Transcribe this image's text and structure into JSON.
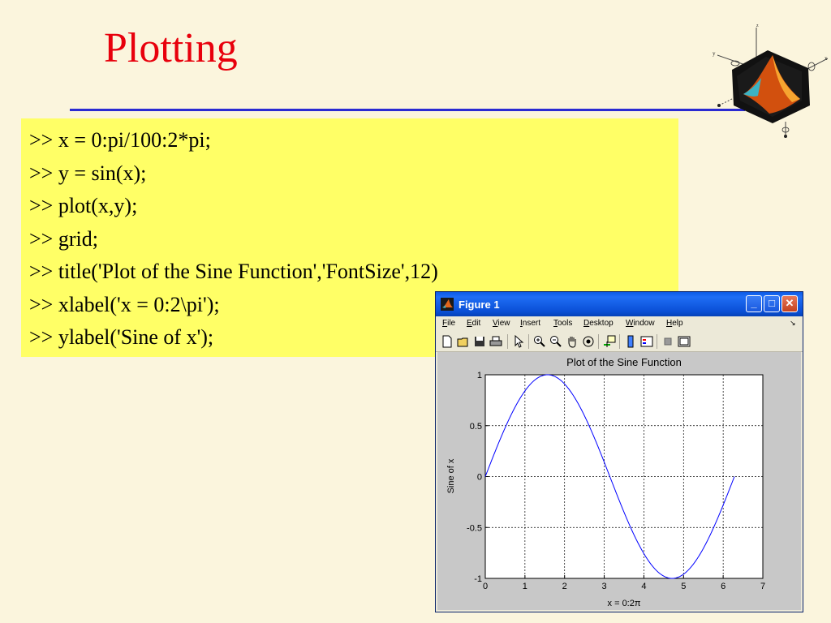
{
  "slide": {
    "title": "Plotting",
    "code_lines": [
      ">> x = 0:pi/100:2*pi;",
      ">> y = sin(x);",
      ">> plot(x,y);",
      ">> grid;",
      ">> title('Plot of the Sine Function','FontSize',12)",
      ">> xlabel('x = 0:2\\pi');",
      ">> ylabel('Sine of x');"
    ]
  },
  "logo": {
    "axis_labels": [
      "z",
      "y",
      "x"
    ]
  },
  "window": {
    "title": "Figure 1",
    "buttons": {
      "minimize": "_",
      "maximize": "□",
      "close": "✕"
    },
    "menu": [
      {
        "label": "File",
        "mnemonic": "F",
        "rest": "ile"
      },
      {
        "label": "Edit",
        "mnemonic": "E",
        "rest": "dit"
      },
      {
        "label": "View",
        "mnemonic": "V",
        "rest": "iew"
      },
      {
        "label": "Insert",
        "mnemonic": "I",
        "rest": "nsert"
      },
      {
        "label": "Tools",
        "mnemonic": "T",
        "rest": "ools"
      },
      {
        "label": "Desktop",
        "mnemonic": "D",
        "rest": "esktop"
      },
      {
        "label": "Window",
        "mnemonic": "W",
        "rest": "indow"
      },
      {
        "label": "Help",
        "mnemonic": "H",
        "rest": "elp"
      }
    ],
    "toolbar": [
      "new-figure-icon",
      "open-file-icon",
      "save-icon",
      "print-icon",
      "edit-plot-arrow-icon",
      "zoom-in-icon",
      "zoom-out-icon",
      "pan-hand-icon",
      "rotate-3d-icon",
      "data-cursor-icon",
      "insert-colorbar-icon",
      "insert-legend-icon",
      "hide-plot-tools-icon",
      "show-plot-tools-icon"
    ]
  },
  "chart_data": {
    "type": "line",
    "title": "Plot of the Sine Function",
    "xlabel": "x = 0:2π",
    "ylabel": "Sine of x",
    "xlim": [
      0,
      7
    ],
    "ylim": [
      -1,
      1
    ],
    "xticks": [
      "0",
      "1",
      "2",
      "3",
      "4",
      "5",
      "6",
      "7"
    ],
    "yticks": [
      "-1",
      "-0.5",
      "0",
      "0.5",
      "1"
    ],
    "grid": true,
    "series": [
      {
        "function": "y = sin(x)",
        "x_range": [
          0,
          6.2832
        ],
        "color": "#0000ff"
      }
    ]
  },
  "colors": {
    "background": "#fbf5dd",
    "title": "#e8000c",
    "rule": "#2a2ad2",
    "code_bg": "#ffff66",
    "line": "#0000ff"
  }
}
